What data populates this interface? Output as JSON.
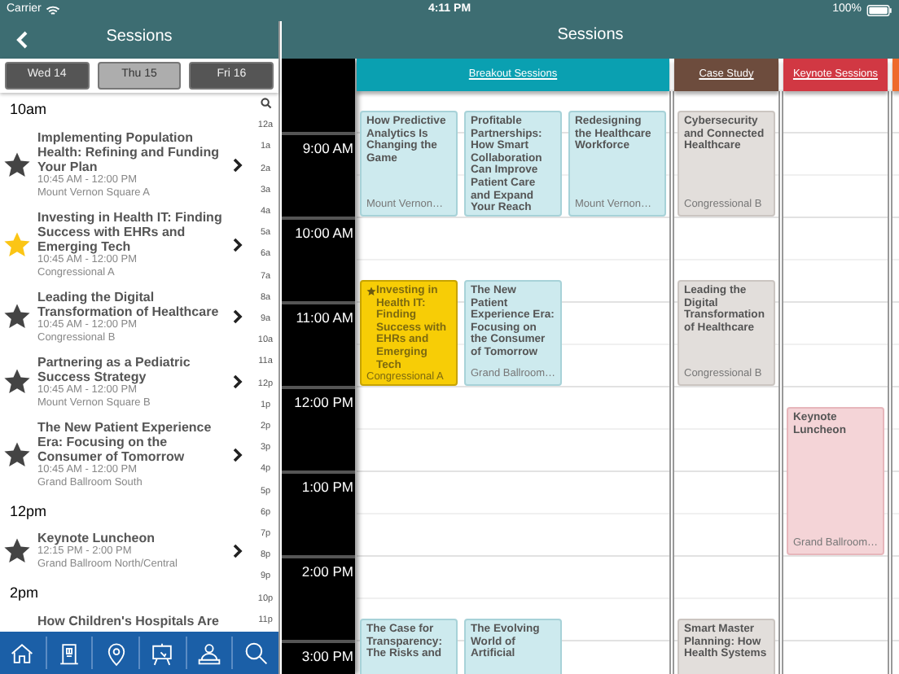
{
  "status_bar": {
    "carrier": "Carrier",
    "time": "4:11 PM",
    "battery": "100%"
  },
  "list_pane": {
    "title": "Sessions",
    "days": [
      {
        "label": "Wed 14",
        "selected": false
      },
      {
        "label": "Thu 15",
        "selected": true
      },
      {
        "label": "Fri 16",
        "selected": false
      }
    ],
    "sections": [
      {
        "heading": "10am",
        "sessions": [
          {
            "title": "Implementing Population Health: Refining and Funding Your Plan",
            "time": "10:45 AM - 12:00 PM",
            "room": "Mount Vernon Square A",
            "starred": false
          },
          {
            "title": "Investing in Health IT: Finding Success with EHRs and Emerging Tech",
            "time": "10:45 AM - 12:00 PM",
            "room": "Congressional A",
            "starred": true
          },
          {
            "title": "Leading the Digital Transformation of Healthcare",
            "time": "10:45 AM - 12:00 PM",
            "room": "Congressional B",
            "starred": false
          },
          {
            "title": "Partnering as a Pediatric Success Strategy",
            "time": "10:45 AM - 12:00 PM",
            "room": "Mount Vernon Square B",
            "starred": false
          },
          {
            "title": "The New Patient Experience Era: Focusing on the Consumer of Tomorrow",
            "time": "10:45 AM - 12:00 PM",
            "room": "Grand Ballroom South",
            "starred": false
          }
        ]
      },
      {
        "heading": "12pm",
        "sessions": [
          {
            "title": "Keynote Luncheon",
            "time": "12:15 PM - 2:00 PM",
            "room": "Grand Ballroom North/Central",
            "starred": false
          }
        ]
      },
      {
        "heading": "2pm",
        "sessions": [
          {
            "title": "How Children's Hospitals Are"
          }
        ]
      }
    ],
    "index": [
      "12a",
      "1a",
      "2a",
      "3a",
      "4a",
      "5a",
      "6a",
      "7a",
      "8a",
      "9a",
      "10a",
      "11a",
      "12p",
      "1p",
      "2p",
      "3p",
      "4p",
      "5p",
      "6p",
      "7p",
      "8p",
      "9p",
      "10p",
      "11p"
    ]
  },
  "grid_pane": {
    "title": "Sessions",
    "time_labels": [
      "9:00 AM",
      "10:00 AM",
      "11:00 AM",
      "12:00 PM",
      "1:00 PM",
      "2:00 PM",
      "3:00 PM"
    ],
    "tracks": [
      {
        "name": "Breakout Sessions",
        "color": "#0aa0b1",
        "events": [
          {
            "title": "How Predictive Analytics Is Changing the Game",
            "room": "Mount Vernon…",
            "starred": false
          },
          {
            "title": "Profitable Partnerships: How Smart Collaboration Can Improve Patient Care and Expand Your Reach",
            "starred": false
          },
          {
            "title": "Redesigning the Healthcare Workforce",
            "room": "Mount Vernon…",
            "starred": false
          },
          {
            "title": "Investing in Health IT: Finding Success with EHRs and Emerging Tech",
            "room": "Congressional A",
            "starred": true
          },
          {
            "title": "The New Patient Experience Era: Focusing on the Consumer of Tomorrow",
            "room": "Grand Ballroom…",
            "starred": false
          },
          {
            "title": "The Case for Transparency: The Risks and",
            "starred": false
          },
          {
            "title": "The Evolving World of Artificial",
            "starred": false
          }
        ]
      },
      {
        "name": "Case Study",
        "color": "#6d4c3d",
        "events": [
          {
            "title": "Cybersecurity and Connected Healthcare",
            "room": "Congressional B",
            "starred": false
          },
          {
            "title": "Leading the Digital Transformation of Healthcare",
            "room": "Congressional B",
            "starred": false
          },
          {
            "title": "Smart Master Planning: How Health Systems",
            "starred": false
          }
        ]
      },
      {
        "name": "Keynote Sessions",
        "color": "#d13843",
        "events": [
          {
            "title": "Keynote Luncheon",
            "room": "Grand Ballroom…",
            "starred": false
          }
        ]
      },
      {
        "color": "#ee6a2c"
      }
    ]
  }
}
